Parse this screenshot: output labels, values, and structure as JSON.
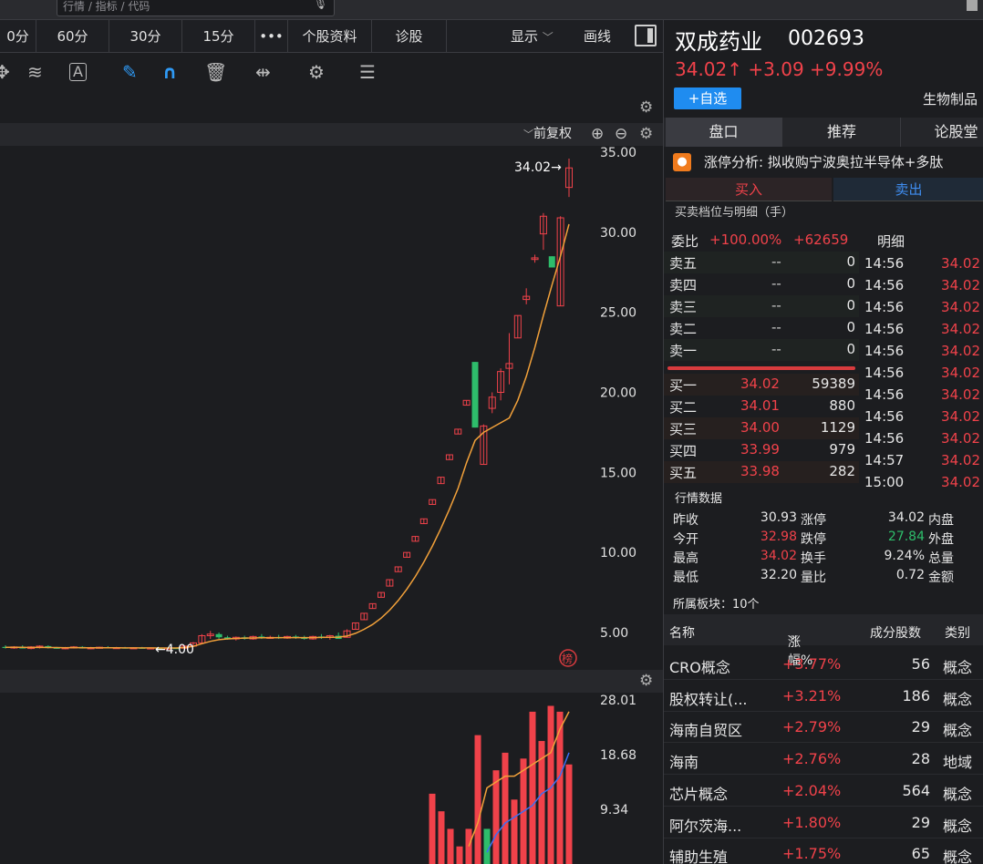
{
  "search": {
    "text": "行情 / 指标 / 代码"
  },
  "periods": [
    "0分",
    "60分",
    "30分",
    "15分",
    "•••",
    "个股资料",
    "诊股"
  ],
  "chart_controls": {
    "display": "显示",
    "draw": "画线",
    "adjust": "前复权"
  },
  "stock": {
    "name": "双成药业",
    "code": "002693",
    "price": "34.02↑",
    "change": "+3.09",
    "change_pct": "+9.99%",
    "watch_label": "+自选",
    "industry": "生物制品"
  },
  "right_tabs": [
    "盘口",
    "推荐",
    "论股堂"
  ],
  "limit_analysis": {
    "label": "涨停分析:",
    "text": "拟收购宁波奥拉半导体+多肽"
  },
  "trade_tabs": {
    "buy": "买入",
    "sell": "卖出"
  },
  "orderbook": {
    "title": "买卖档位与明细（手）",
    "weibi_label": "委比",
    "weibi_pct": "+100.00%",
    "weibi_diff": "+62659",
    "detail_label": "明细",
    "asks": [
      {
        "label": "卖五",
        "price": "--",
        "vol": "0"
      },
      {
        "label": "卖四",
        "price": "--",
        "vol": "0"
      },
      {
        "label": "卖三",
        "price": "--",
        "vol": "0"
      },
      {
        "label": "卖二",
        "price": "--",
        "vol": "0"
      },
      {
        "label": "卖一",
        "price": "--",
        "vol": "0"
      }
    ],
    "bids": [
      {
        "label": "买一",
        "price": "34.02",
        "vol": "59389"
      },
      {
        "label": "买二",
        "price": "34.01",
        "vol": "880"
      },
      {
        "label": "买三",
        "price": "34.00",
        "vol": "1129"
      },
      {
        "label": "买四",
        "price": "33.99",
        "vol": "979"
      },
      {
        "label": "买五",
        "price": "33.98",
        "vol": "282"
      }
    ]
  },
  "ticks": [
    {
      "time": "14:56",
      "price": "34.02"
    },
    {
      "time": "14:56",
      "price": "34.02"
    },
    {
      "time": "14:56",
      "price": "34.02"
    },
    {
      "time": "14:56",
      "price": "34.02"
    },
    {
      "time": "14:56",
      "price": "34.02"
    },
    {
      "time": "14:56",
      "price": "34.02"
    },
    {
      "time": "14:56",
      "price": "34.02"
    },
    {
      "time": "14:56",
      "price": "34.02"
    },
    {
      "time": "14:56",
      "price": "34.02"
    },
    {
      "time": "14:57",
      "price": "34.02"
    },
    {
      "time": "15:00",
      "price": "34.02"
    }
  ],
  "quote": {
    "title": "行情数据",
    "rows": [
      {
        "l1": "昨收",
        "v1": "30.93",
        "l2": "涨停",
        "v2": "34.02",
        "l3": "内盘"
      },
      {
        "l1": "今开",
        "v1": "32.98",
        "l2": "跌停",
        "v2": "27.84",
        "l3": "外盘"
      },
      {
        "l1": "最高",
        "v1": "34.02",
        "l2": "换手",
        "v2": "9.24%",
        "l3": "总量"
      },
      {
        "l1": "最低",
        "v1": "32.20",
        "l2": "量比",
        "v2": "0.72",
        "l3": "金额"
      }
    ]
  },
  "sectors": {
    "title": "所属板块：10个",
    "headers": {
      "name": "名称",
      "chg": "涨幅%",
      "count": "成分股数",
      "type": "类别"
    },
    "rows": [
      {
        "name": "CRO概念",
        "chg": "+3.77%",
        "count": "56",
        "type": "概念"
      },
      {
        "name": "股权转让(...",
        "chg": "+3.21%",
        "count": "186",
        "type": "概念"
      },
      {
        "name": "海南自贸区",
        "chg": "+2.79%",
        "count": "29",
        "type": "概念"
      },
      {
        "name": "海南",
        "chg": "+2.76%",
        "count": "28",
        "type": "地域"
      },
      {
        "name": "芯片概念",
        "chg": "+2.04%",
        "count": "564",
        "type": "概念"
      },
      {
        "name": "阿尔茨海...",
        "chg": "+1.80%",
        "count": "29",
        "type": "概念"
      },
      {
        "name": "辅助生殖",
        "chg": "+1.75%",
        "count": "65",
        "type": "概念"
      }
    ]
  },
  "colors": {
    "up": "#f0424a",
    "down": "#2ebd6b",
    "ma": "#f2a13a",
    "vol_ma2": "#3b6ff5"
  },
  "chart_data": [
    {
      "type": "candlestick",
      "y_ticks": [
        "35.00",
        "30.00",
        "25.00",
        "20.00",
        "15.00",
        "10.00",
        "5.00"
      ],
      "ylim": [
        2.3,
        35.4
      ],
      "annotations": {
        "max": "34.02→",
        "min": "←4.00",
        "badge": "榜"
      },
      "candles": [
        {
          "o": 4.1,
          "h": 4.2,
          "l": 4.0,
          "c": 4.05
        },
        {
          "o": 4.05,
          "h": 4.15,
          "l": 3.98,
          "c": 4.1
        },
        {
          "o": 4.1,
          "h": 4.2,
          "l": 4.0,
          "c": 4.0
        },
        {
          "o": 4.0,
          "h": 4.15,
          "l": 3.95,
          "c": 4.1
        },
        {
          "o": 4.1,
          "h": 4.2,
          "l": 4.0,
          "c": 4.15
        },
        {
          "o": 4.15,
          "h": 4.2,
          "l": 4.0,
          "c": 4.05
        },
        {
          "o": 4.05,
          "h": 4.1,
          "l": 3.98,
          "c": 4.0
        },
        {
          "o": 4.0,
          "h": 4.1,
          "l": 3.95,
          "c": 4.05
        },
        {
          "o": 4.05,
          "h": 4.15,
          "l": 4.0,
          "c": 4.1
        },
        {
          "o": 4.1,
          "h": 4.15,
          "l": 4.0,
          "c": 4.0
        },
        {
          "o": 4.0,
          "h": 4.1,
          "l": 3.95,
          "c": 4.05
        },
        {
          "o": 4.05,
          "h": 4.12,
          "l": 4.0,
          "c": 4.08
        },
        {
          "o": 4.08,
          "h": 4.15,
          "l": 4.02,
          "c": 4.04
        },
        {
          "o": 4.04,
          "h": 4.1,
          "l": 4.0,
          "c": 4.06
        },
        {
          "o": 4.06,
          "h": 4.1,
          "l": 4.0,
          "c": 4.02
        },
        {
          "o": 4.02,
          "h": 4.08,
          "l": 3.99,
          "c": 4.05
        },
        {
          "o": 4.05,
          "h": 4.1,
          "l": 4.0,
          "c": 4.01
        },
        {
          "o": 4.01,
          "h": 4.06,
          "l": 3.97,
          "c": 4.04
        },
        {
          "o": 4.04,
          "h": 4.08,
          "l": 4.0,
          "c": 4.0
        },
        {
          "o": 4.0,
          "h": 4.05,
          "l": 4.0,
          "c": 4.03
        },
        {
          "o": 4.03,
          "h": 4.06,
          "l": 4.0,
          "c": 4.02
        },
        {
          "o": 4.02,
          "h": 4.2,
          "l": 4.0,
          "c": 4.15
        },
        {
          "o": 4.15,
          "h": 4.4,
          "l": 4.1,
          "c": 4.35
        },
        {
          "o": 4.35,
          "h": 4.9,
          "l": 4.3,
          "c": 4.8
        },
        {
          "o": 4.8,
          "h": 5.1,
          "l": 4.6,
          "c": 4.9
        },
        {
          "o": 4.9,
          "h": 5.0,
          "l": 4.6,
          "c": 4.7
        },
        {
          "o": 4.7,
          "h": 4.8,
          "l": 4.55,
          "c": 4.6
        },
        {
          "o": 4.6,
          "h": 4.75,
          "l": 4.5,
          "c": 4.7
        },
        {
          "o": 4.7,
          "h": 4.8,
          "l": 4.55,
          "c": 4.6
        },
        {
          "o": 4.6,
          "h": 4.8,
          "l": 4.55,
          "c": 4.75
        },
        {
          "o": 4.75,
          "h": 4.9,
          "l": 4.6,
          "c": 4.65
        },
        {
          "o": 4.65,
          "h": 4.8,
          "l": 4.6,
          "c": 4.7
        },
        {
          "o": 4.7,
          "h": 4.85,
          "l": 4.6,
          "c": 4.65
        },
        {
          "o": 4.65,
          "h": 4.8,
          "l": 4.6,
          "c": 4.75
        },
        {
          "o": 4.75,
          "h": 4.85,
          "l": 4.6,
          "c": 4.7
        },
        {
          "o": 4.7,
          "h": 4.8,
          "l": 4.55,
          "c": 4.6
        },
        {
          "o": 4.6,
          "h": 4.8,
          "l": 4.55,
          "c": 4.75
        },
        {
          "o": 4.75,
          "h": 4.9,
          "l": 4.6,
          "c": 4.7
        },
        {
          "o": 4.7,
          "h": 4.85,
          "l": 4.55,
          "c": 4.8
        },
        {
          "o": 4.8,
          "h": 5.0,
          "l": 4.6,
          "c": 4.6
        },
        {
          "o": 4.7,
          "h": 5.2,
          "l": 4.7,
          "c": 5.1
        },
        {
          "o": 5.2,
          "h": 5.6,
          "l": 5.2,
          "c": 5.6
        },
        {
          "o": 5.8,
          "h": 6.2,
          "l": 5.8,
          "c": 6.2
        },
        {
          "o": 6.5,
          "h": 6.8,
          "l": 6.5,
          "c": 6.8
        },
        {
          "o": 7.2,
          "h": 7.5,
          "l": 7.2,
          "c": 7.5
        },
        {
          "o": 7.9,
          "h": 8.3,
          "l": 7.9,
          "c": 8.3
        },
        {
          "o": 8.8,
          "h": 9.1,
          "l": 8.8,
          "c": 9.1
        },
        {
          "o": 9.7,
          "h": 10.0,
          "l": 9.7,
          "c": 10.0
        },
        {
          "o": 10.7,
          "h": 11.0,
          "l": 10.7,
          "c": 11.0
        },
        {
          "o": 11.8,
          "h": 12.1,
          "l": 11.8,
          "c": 12.1
        },
        {
          "o": 13.0,
          "h": 13.3,
          "l": 13.0,
          "c": 13.3
        },
        {
          "o": 14.3,
          "h": 14.7,
          "l": 14.3,
          "c": 14.7
        },
        {
          "o": 15.8,
          "h": 16.1,
          "l": 15.8,
          "c": 16.1
        },
        {
          "o": 17.4,
          "h": 17.7,
          "l": 17.4,
          "c": 17.7
        },
        {
          "o": 19.2,
          "h": 19.5,
          "l": 19.2,
          "c": 19.5
        },
        {
          "o": 21.9,
          "h": 21.9,
          "l": 17.8,
          "c": 17.8
        },
        {
          "o": 15.5,
          "h": 18.0,
          "l": 15.5,
          "c": 17.9
        },
        {
          "o": 19.0,
          "h": 20.0,
          "l": 18.7,
          "c": 19.7
        },
        {
          "o": 20.0,
          "h": 21.5,
          "l": 19.5,
          "c": 21.3
        },
        {
          "o": 21.5,
          "h": 23.7,
          "l": 20.5,
          "c": 21.8
        },
        {
          "o": 23.4,
          "h": 24.8,
          "l": 23.4,
          "c": 24.8
        },
        {
          "o": 25.8,
          "h": 26.5,
          "l": 25.5,
          "c": 26.0
        },
        {
          "o": 28.3,
          "h": 28.6,
          "l": 28.1,
          "c": 28.4
        },
        {
          "o": 29.9,
          "h": 31.2,
          "l": 28.9,
          "c": 31.0
        },
        {
          "o": 28.5,
          "h": 28.5,
          "l": 27.8,
          "c": 27.8
        },
        {
          "o": 25.4,
          "h": 31.0,
          "l": 25.4,
          "c": 30.9
        },
        {
          "o": 32.8,
          "h": 34.6,
          "l": 32.2,
          "c": 34.02
        }
      ],
      "ma": [
        4.08,
        4.07,
        4.07,
        4.06,
        4.07,
        4.06,
        4.06,
        4.05,
        4.06,
        4.05,
        4.05,
        4.05,
        4.05,
        4.05,
        4.04,
        4.04,
        4.04,
        4.04,
        4.03,
        4.03,
        4.03,
        4.06,
        4.14,
        4.3,
        4.45,
        4.55,
        4.6,
        4.63,
        4.65,
        4.66,
        4.67,
        4.67,
        4.68,
        4.68,
        4.68,
        4.68,
        4.68,
        4.69,
        4.7,
        4.71,
        4.78,
        4.95,
        5.2,
        5.5,
        5.9,
        6.4,
        7.0,
        7.7,
        8.5,
        9.4,
        10.4,
        11.5,
        12.7,
        14.0,
        15.6,
        17.0,
        17.5,
        17.8,
        18.1,
        18.4,
        19.5,
        21.0,
        22.8,
        24.8,
        26.7,
        28.5,
        30.5
      ]
    },
    {
      "type": "bar",
      "y_ticks": [
        "28.01",
        "18.68",
        "9.34"
      ],
      "ylim": [
        0,
        28.01
      ],
      "series": [
        {
          "values": [
            12,
            9,
            6,
            3,
            6,
            22,
            6,
            16,
            19,
            11,
            18,
            26,
            21,
            27,
            26,
            17
          ]
        },
        {
          "values": [
            null,
            null,
            null,
            null,
            3,
            7,
            13,
            14,
            15,
            15,
            16,
            17,
            18,
            19,
            23,
            26
          ]
        },
        {
          "values": [
            null,
            null,
            null,
            null,
            null,
            null,
            2,
            5,
            7,
            8,
            9,
            10,
            12,
            13,
            15,
            19
          ]
        }
      ]
    }
  ]
}
